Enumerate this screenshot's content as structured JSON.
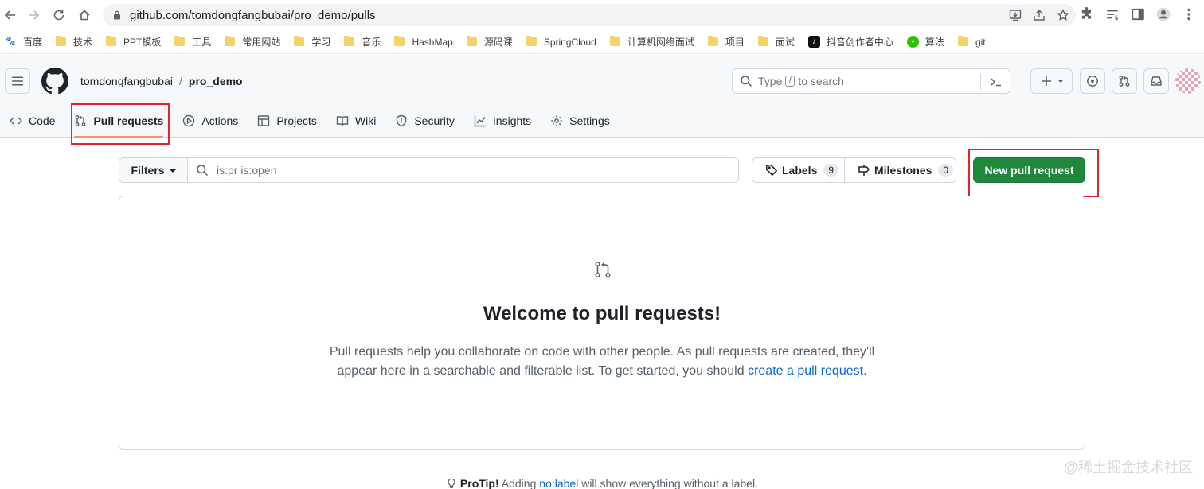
{
  "browser": {
    "url": "github.com/tomdongfangbubai/pro_demo/pulls",
    "bookmarks": [
      {
        "label": "百度",
        "kind": "baidu"
      },
      {
        "label": "技术",
        "kind": "folder"
      },
      {
        "label": "PPT模板",
        "kind": "folder"
      },
      {
        "label": "工具",
        "kind": "folder"
      },
      {
        "label": "常用网站",
        "kind": "folder"
      },
      {
        "label": "学习",
        "kind": "folder"
      },
      {
        "label": "音乐",
        "kind": "folder"
      },
      {
        "label": "HashMap",
        "kind": "folder"
      },
      {
        "label": "源码课",
        "kind": "folder"
      },
      {
        "label": "SpringCloud",
        "kind": "folder"
      },
      {
        "label": "计算机网络面试",
        "kind": "folder"
      },
      {
        "label": "项目",
        "kind": "folder"
      },
      {
        "label": "面试",
        "kind": "folder"
      },
      {
        "label": "抖音创作者中心",
        "kind": "douyin"
      },
      {
        "label": "算法",
        "kind": "wechat"
      },
      {
        "label": "git",
        "kind": "folder"
      }
    ]
  },
  "header": {
    "owner": "tomdongfangbubai",
    "separator": "/",
    "repo": "pro_demo",
    "search_prefix": "Type",
    "search_key": "/",
    "search_suffix": "to search"
  },
  "repo_nav": {
    "tabs": [
      {
        "label": "Code",
        "icon": "code-icon",
        "active": false
      },
      {
        "label": "Pull requests",
        "icon": "git-pull-request-icon",
        "active": true
      },
      {
        "label": "Actions",
        "icon": "play-icon",
        "active": false
      },
      {
        "label": "Projects",
        "icon": "table-icon",
        "active": false
      },
      {
        "label": "Wiki",
        "icon": "book-icon",
        "active": false
      },
      {
        "label": "Security",
        "icon": "shield-icon",
        "active": false
      },
      {
        "label": "Insights",
        "icon": "graph-icon",
        "active": false
      },
      {
        "label": "Settings",
        "icon": "gear-icon",
        "active": false
      }
    ]
  },
  "toolbar": {
    "filters_label": "Filters",
    "search_value": "is:pr is:open",
    "labels_label": "Labels",
    "labels_count": "9",
    "milestones_label": "Milestones",
    "milestones_count": "0",
    "new_pr_label": "New pull request"
  },
  "blank_state": {
    "title": "Welcome to pull requests!",
    "body_before": "Pull requests help you collaborate on code with other people. As pull requests are created, they'll appear here in a searchable and filterable list. To get started, you should ",
    "link": "create a pull request",
    "body_after": "."
  },
  "protip": {
    "label": "ProTip!",
    "before": " Adding ",
    "link": "no:label",
    "after": " will show everything without a label."
  },
  "watermark": "@稀土掘金技术社区",
  "colors": {
    "primary_button": "#1f883d",
    "link": "#0969da",
    "active_tab_underline": "#fd8c73",
    "annotation_box": "#e0252b"
  }
}
